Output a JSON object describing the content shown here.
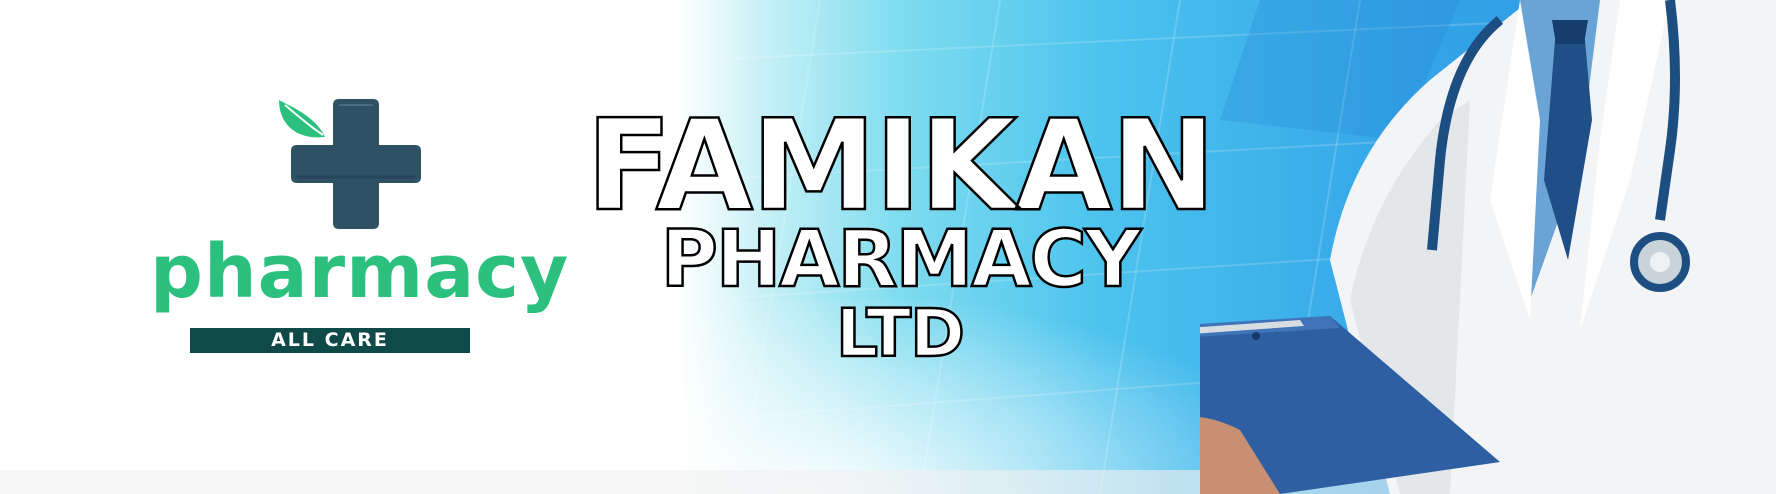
{
  "logo": {
    "icon": "pharmacy-cross-leaf-icon",
    "word": "pharmacy",
    "tagline": "ALL CARE",
    "colors": {
      "cross": "#2f5164",
      "leaf": "#2cc07f",
      "word": "#2cc07f",
      "tagline_bg": "#0f4a48"
    }
  },
  "title": {
    "line1": "FAMIKAN",
    "line2": "PHARMACY",
    "line3": "LTD"
  },
  "photo": {
    "subject": "doctor-with-clipboard-icon"
  },
  "colors": {
    "background_light": "#ffffff",
    "background_blue": "#34a6e8",
    "accent_cyan": "#7fdcef"
  }
}
